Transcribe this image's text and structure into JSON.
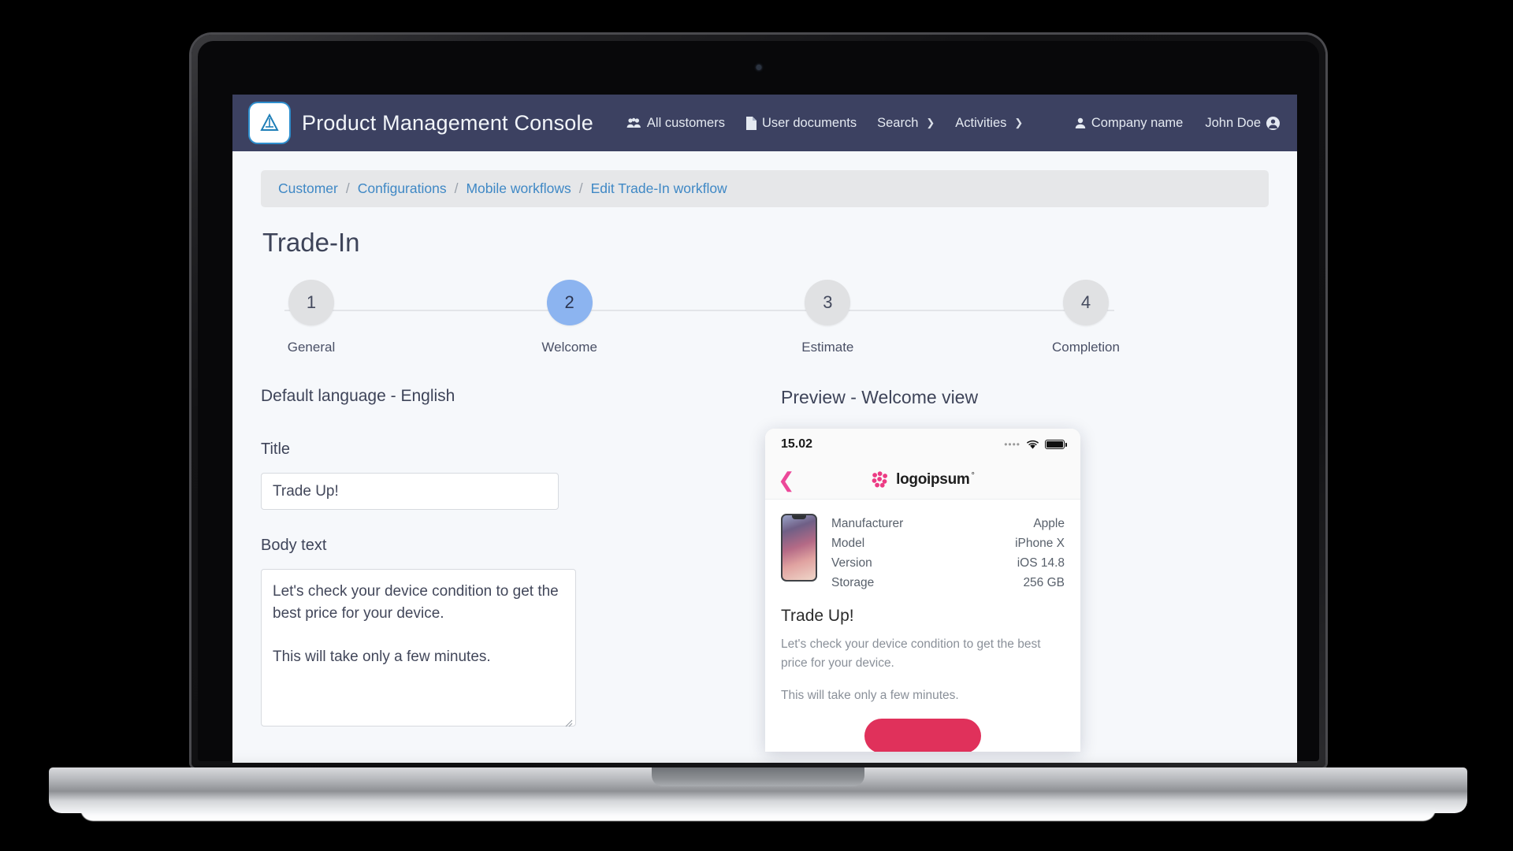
{
  "navbar": {
    "brand_title": "Product Management Console",
    "logo_icon": "triangle-logo-icon",
    "links": [
      {
        "label": "All customers",
        "icon": "users-icon",
        "chevron": ""
      },
      {
        "label": "User documents",
        "icon": "document-icon",
        "chevron": ""
      },
      {
        "label": "Search",
        "icon": "",
        "chevron": "❯"
      },
      {
        "label": "Activities",
        "icon": "",
        "chevron": "❯"
      }
    ],
    "company": {
      "label": "Company name",
      "icon": "person-icon"
    },
    "user": {
      "label": "John Doe",
      "icon": "account-circle-icon"
    }
  },
  "breadcrumb": {
    "separator": "/",
    "items": [
      "Customer",
      "Configurations",
      "Mobile workflows",
      "Edit Trade-In workflow"
    ]
  },
  "page": {
    "title": "Trade-In"
  },
  "stepper": {
    "active_index": 1,
    "steps": [
      {
        "number": "1",
        "label": "General"
      },
      {
        "number": "2",
        "label": "Welcome"
      },
      {
        "number": "3",
        "label": "Estimate"
      },
      {
        "number": "4",
        "label": "Completion"
      }
    ]
  },
  "form": {
    "language_heading": "Default language - English",
    "title_label": "Title",
    "title_value": "Trade Up!",
    "title_placeholder": "Title",
    "body_label": "Body text",
    "body_value": "Let's check your device condition to get the best price for your device.\n\nThis will take only a few minutes.",
    "body_placeholder": "Body text"
  },
  "preview": {
    "heading": "Preview - Welcome view",
    "status_bar": {
      "time": "15.02",
      "signal_icon": "signal-dots-icon",
      "wifi_icon": "wifi-icon",
      "battery_icon": "battery-full-icon"
    },
    "app_header": {
      "back_icon": "back-chevron-icon",
      "logo_icon": "logoipsum-dots-icon",
      "logo_name": "logoipsum",
      "logo_mark": "°"
    },
    "device": {
      "image_alt": "iphone-x-device-image",
      "specs": [
        {
          "key": "Manufacturer",
          "value": "Apple"
        },
        {
          "key": "Model",
          "value": "iPhone X"
        },
        {
          "key": "Version",
          "value": "iOS 14.8"
        },
        {
          "key": "Storage",
          "value": "256 GB"
        }
      ]
    },
    "content": {
      "title": "Trade Up!",
      "paragraph_1": "Let's check your device condition to get the best price for your device.",
      "paragraph_2": "This will take only a few minutes."
    },
    "cta": {
      "label": ""
    }
  },
  "colors": {
    "navbar_bg": "#3c4161",
    "accent_blue": "#8cb4f0",
    "link_blue": "#3f88c5",
    "page_bg": "#f6f8fb",
    "brand_pink": "#ec4899",
    "cta_pink": "#e0315b"
  }
}
